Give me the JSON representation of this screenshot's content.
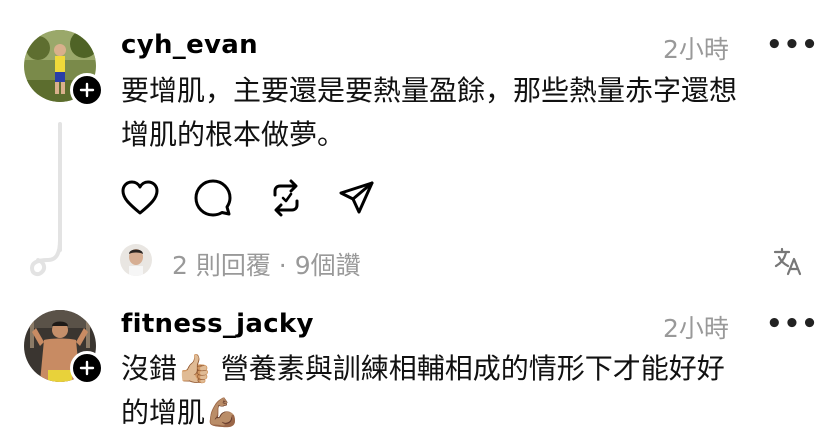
{
  "comments": [
    {
      "username": "cyh_evan",
      "time": "2小時",
      "more": "•••",
      "text_line1": "要增肌，主要還是要熱量盈餘，那些熱量赤字還想",
      "text_line2": "增肌的根本做夢。",
      "footer": "2 則回覆 · 9個讚"
    },
    {
      "username": "fitness_jacky",
      "time": "2小時",
      "more": "•••",
      "text_line1": "沒錯👍🏼 營養素與訓練相輔相成的情形下才能好好",
      "text_line2": "的增肌💪🏽"
    }
  ],
  "icons": {
    "like": "heart-icon",
    "reply": "comment-icon",
    "repost": "repost-icon",
    "share": "send-icon",
    "translate": "translate-icon"
  }
}
